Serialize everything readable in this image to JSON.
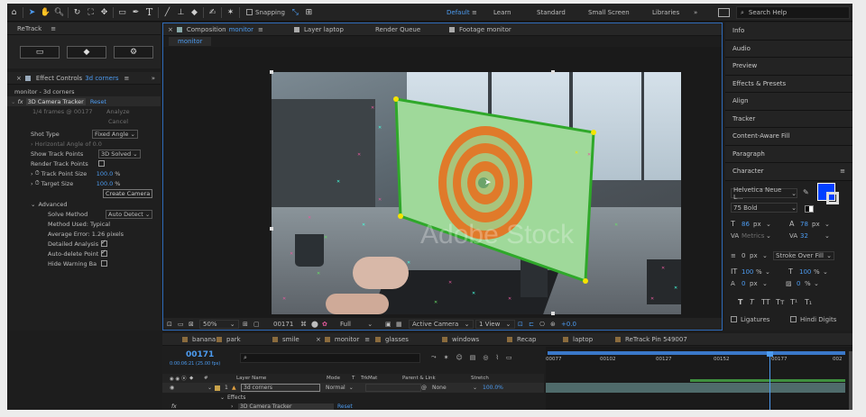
{
  "toolbar": {
    "snapping_label": "Snapping",
    "workspaces": [
      "Default",
      "Learn",
      "Standard",
      "Small Screen",
      "Libraries"
    ],
    "active_workspace": "Default",
    "search_placeholder": "Search Help"
  },
  "retrack_panel": {
    "title": "ReTrack"
  },
  "effect_controls": {
    "tab_label": "Effect Controls",
    "tab_target": "3d corners",
    "layer_path": "monitor - 3d corners",
    "effect_name": "3D Camera Tracker",
    "reset_label": "Reset",
    "status_text": "1/4 frames @ 00177",
    "analyze_label": "Analyze",
    "cancel_label": "Cancel",
    "rows": {
      "shot_type_label": "Shot Type",
      "shot_type_value": "Fixed Angle",
      "horizontal_angle_label": "Horizontal Angle of",
      "horizontal_angle_value": "0.0",
      "show_track_points_label": "Show Track Points",
      "show_track_points_value": "3D Solved",
      "render_track_points_label": "Render Track Points",
      "track_point_size_label": "Track Point Size",
      "track_point_size_value": "100.0",
      "target_size_label": "Target Size",
      "target_size_value": "100.0",
      "percent": "%",
      "create_camera_label": "Create Camera",
      "advanced_label": "Advanced",
      "solve_method_label": "Solve Method",
      "solve_method_value": "Auto Detect",
      "method_used": "Method Used: Typical",
      "average_error": "Average Error: 1.26 pixels",
      "detailed_analysis_label": "Detailed Analysis",
      "auto_delete_label": "Auto-delete Point",
      "hide_warning_label": "Hide Warning Ba"
    }
  },
  "composition": {
    "tabs": [
      {
        "label": "Composition",
        "target": "monitor",
        "active": true
      },
      {
        "label": "Layer laptop",
        "active": false
      },
      {
        "label": "Render Queue",
        "active": false
      },
      {
        "label": "Footage monitor",
        "active": false
      }
    ],
    "breadcrumb": "monitor",
    "watermark": "Adobe Stock",
    "footer": {
      "zoom": "50%",
      "timecode": "00171",
      "resolution": "Full",
      "camera": "Active Camera",
      "views": "1 View",
      "exposure": "+0.0"
    }
  },
  "right_panels": {
    "items": [
      "Info",
      "Audio",
      "Preview",
      "Effects & Presets",
      "Align",
      "Tracker",
      "Content-Aware Fill",
      "Paragraph",
      "Character"
    ],
    "character": {
      "font_family": "Helvetica Neue L...",
      "font_style": "75 Bold",
      "font_size": "86",
      "leading": "78",
      "kerning": "Metrics",
      "tracking": "32",
      "stroke_width": "0",
      "stroke_type": "Stroke Over Fill",
      "vertical_scale": "100",
      "horizontal_scale": "100",
      "baseline_shift": "0",
      "tsume": "0",
      "unit_px": "px",
      "unit_pct": "%",
      "style_buttons": [
        "T",
        "T",
        "TT",
        "Tт",
        "T¹",
        "T₁"
      ],
      "ligatures_label": "Ligatures",
      "hindi_digits_label": "Hindi Digits",
      "fill_color": "#0040ff"
    }
  },
  "timeline": {
    "tabs": [
      {
        "label": "banana",
        "color": "#8a6b3d"
      },
      {
        "label": "park",
        "color": "#8a6b3d"
      },
      {
        "label": "smile",
        "color": "#8a6b3d"
      },
      {
        "label": "monitor",
        "color": "#8a6b3d",
        "active": true
      },
      {
        "label": "glasses",
        "color": "#8a6b3d"
      },
      {
        "label": "windows",
        "color": "#8a6b3d"
      },
      {
        "label": "Recap",
        "color": "#8a6b3d"
      },
      {
        "label": "laptop",
        "color": "#8a6b3d"
      },
      {
        "label": "ReTrack Pin 549007",
        "color": "#8a6b3d"
      }
    ],
    "current_time": "00171",
    "time_sub": "0:00:06:21 (25.00 fps)",
    "search_placeholder": "",
    "columns": {
      "layer_name": "Layer Name",
      "mode": "Mode",
      "t": "T",
      "trkmat": "TrkMat",
      "parent": "Parent & Link",
      "stretch": "Stretch"
    },
    "ruler": [
      "00077",
      "00102",
      "00127",
      "00152",
      "00177",
      "002"
    ],
    "layer": {
      "index": "1",
      "name": "3d corners",
      "mode": "Normal",
      "parent": "None",
      "stretch": "100.0%"
    },
    "effects_label": "Effects",
    "effect_row": {
      "name": "3D Camera Tracker",
      "reset": "Reset"
    }
  }
}
